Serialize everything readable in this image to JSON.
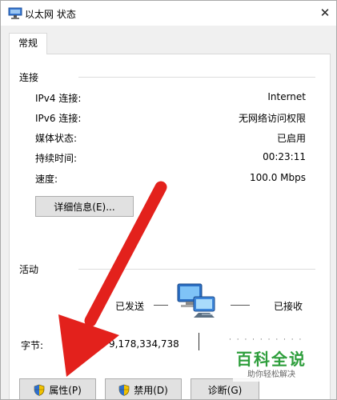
{
  "window": {
    "title": "以太网 状态",
    "close_glyph": "✕"
  },
  "tabs": [
    {
      "label": "常规"
    }
  ],
  "connection": {
    "title": "连接",
    "rows": [
      {
        "label": "IPv4 连接:",
        "value": "Internet"
      },
      {
        "label": "IPv6 连接:",
        "value": "无网络访问权限"
      },
      {
        "label": "媒体状态:",
        "value": "已启用"
      },
      {
        "label": "持续时间:",
        "value": "00:23:11"
      },
      {
        "label": "速度:",
        "value": "100.0 Mbps"
      }
    ],
    "details_button": "详细信息(E)..."
  },
  "activity": {
    "title": "活动",
    "sent_label": "已发送",
    "received_label": "已接收",
    "bytes_label": "字节:",
    "bytes_sent": "9,178,334,738"
  },
  "buttons": {
    "properties": "属性(P)",
    "disable": "禁用(D)",
    "diagnose": "诊断(G)"
  },
  "watermark": {
    "title": "百科全说",
    "subtitle": "助你轻松解决"
  },
  "colors": {
    "arrow": "#e3211c",
    "watermark_green": "#2e9e3c"
  },
  "icons": {
    "title": "network-adapter-icon",
    "activity": "network-computers-icon",
    "shield": "uac-shield-icon"
  }
}
